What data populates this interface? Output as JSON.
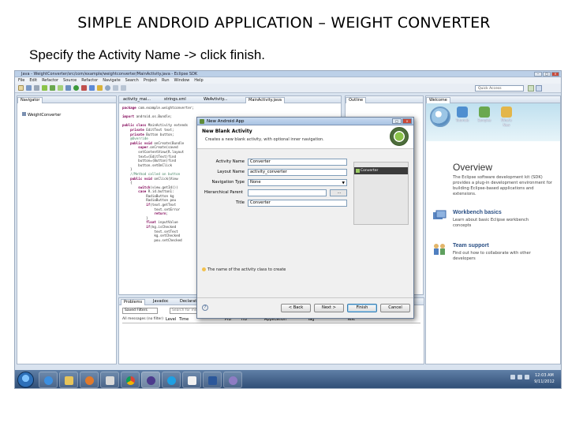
{
  "slide": {
    "title": "SIMPLE ANDROID APPLICATION – WEIGHT CONVERTER",
    "caption": "Specify the Activity Name -> click finish."
  },
  "eclipse": {
    "window_title": "Java - WeightConverter/src/com/example/weightconverter/MainActivity.java - Eclipse SDK",
    "menu": [
      "File",
      "Edit",
      "Refactor",
      "Source",
      "Refactor",
      "Navigate",
      "Search",
      "Project",
      "Run",
      "Window",
      "Help"
    ],
    "quick_access": "Quick Access",
    "navigator_tab": "Navigator",
    "project_item": "WeightConverter",
    "editor_tabs": [
      "activity_mai...",
      "strings.xml",
      "WeAvtivity...",
      "MainActivity.java"
    ],
    "outline_tab": "Outline",
    "welcome_tab": "Welcome",
    "welcome_icons": [
      "Tutorials",
      "Samples",
      "What's New"
    ],
    "overview_title": "Overview",
    "overview_text": "The Eclipse software development kit (SDK) provides a plug-in development environment for building Eclipse-based applications and extensions.",
    "sections": [
      {
        "title": "Workbench basics",
        "desc": "Learn about basic Eclipse workbench concepts"
      },
      {
        "title": "Team support",
        "desc": "Find out how to collaborate with other developers"
      }
    ],
    "problems_tabs": [
      "Problems",
      "Javadoc",
      "Declaration"
    ],
    "problems_filter": "Saved Filters",
    "problems_search": "Search for messages",
    "problems_side": "All messages (no filter)",
    "problems_columns": [
      "Level",
      "Time",
      "PID",
      "TID",
      "Application",
      "Tag",
      "Text"
    ]
  },
  "dialog": {
    "title": "New Android App",
    "heading": "New Blank Activity",
    "subheading": "Creates a new blank activity, with optional inner navigation.",
    "fields": [
      {
        "label": "Activity Name",
        "value": "Converter"
      },
      {
        "label": "Layout Name",
        "value": "activity_converter"
      },
      {
        "label": "Navigation Type",
        "value": "None"
      },
      {
        "label": "Hierarchical Parent",
        "value": ""
      },
      {
        "label": "Title",
        "value": "Converter"
      }
    ],
    "preview_label": "Converter",
    "info": "The name of the activity class to create",
    "buttons": {
      "help": "?",
      "back": "< Back",
      "next": "Next >",
      "finish": "Finish",
      "cancel": "Cancel"
    }
  },
  "taskbar": {
    "time": "12:03 AM",
    "date": "9/11/2012"
  }
}
